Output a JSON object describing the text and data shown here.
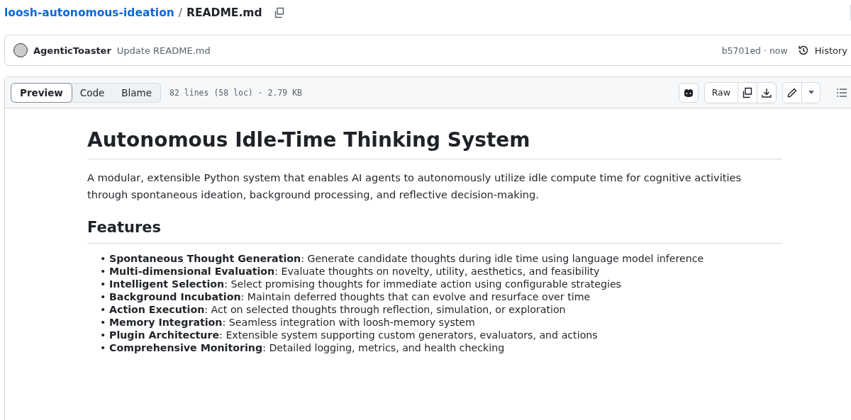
{
  "breadcrumb": {
    "repo": "loosh-autonomous-ideation",
    "separator": "/",
    "file": "README.md"
  },
  "commit": {
    "author": "AgenticToaster",
    "message": "Update README.md",
    "sha": "b5701ed · now",
    "history": "History"
  },
  "toolbar": {
    "tabs": [
      {
        "label": "Preview",
        "selected": true
      },
      {
        "label": "Code",
        "selected": false
      },
      {
        "label": "Blame",
        "selected": false
      }
    ],
    "info": "82 lines (58 loc) · 2.79 KB",
    "raw": "Raw"
  },
  "readme": {
    "title": "Autonomous Idle-Time Thinking System",
    "intro": "A modular, extensible Python system that enables AI agents to autonomously utilize idle compute time for cognitive activities through spontaneous ideation, background processing, and reflective decision-making.",
    "features_heading": "Features",
    "bullet": "•",
    "features": [
      {
        "name": "Spontaneous Thought Generation",
        "text": ": Generate candidate thoughts during idle time using language model inference"
      },
      {
        "name": "Multi-dimensional Evaluation",
        "text": ": Evaluate thoughts on novelty, utility, aesthetics, and feasibility"
      },
      {
        "name": "Intelligent Selection",
        "text": ": Select promising thoughts for immediate action using configurable strategies"
      },
      {
        "name": "Background Incubation",
        "text": ": Maintain deferred thoughts that can evolve and resurface over time"
      },
      {
        "name": "Action Execution",
        "text": ": Act on selected thoughts through reflection, simulation, or exploration"
      },
      {
        "name": "Memory Integration",
        "text": ": Seamless integration with loosh-memory system"
      },
      {
        "name": "Plugin Architecture",
        "text": ": Extensible system supporting custom generators, evaluators, and actions"
      },
      {
        "name": "Comprehensive Monitoring",
        "text": ": Detailed logging, metrics, and health checking"
      }
    ]
  }
}
